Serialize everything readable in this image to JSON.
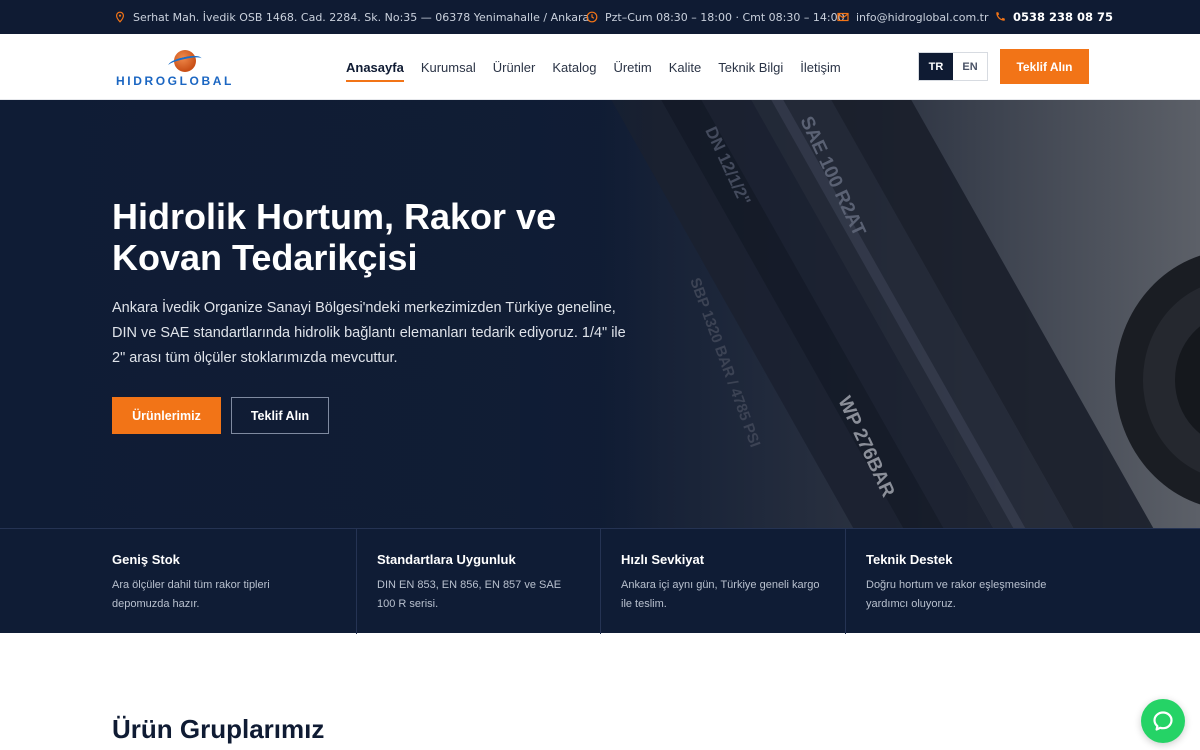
{
  "topbar": {
    "address": "Serhat Mah. İvedik OSB 1468. Cad. 2284. Sk. No:35 — 06378 Yenimahalle / Ankara",
    "hours": "Pzt–Cum 08:30 – 18:00 · Cmt 08:30 – 14:00",
    "email": "info@hidroglobal.com.tr",
    "phone": "0538 238 08 75"
  },
  "header": {
    "logo_text": "HIDROGLOBAL",
    "nav": [
      "Anasayfa",
      "Kurumsal",
      "Ürünler",
      "Katalog",
      "Üretim",
      "Kalite",
      "Teknik Bilgi",
      "İletişim"
    ],
    "lang_active": "TR",
    "lang_other": "EN",
    "cta": "Teklif Alın"
  },
  "hero": {
    "title": "Hidrolik Hortum, Rakor ve Kovan Tedarikçisi",
    "description": "Ankara İvedik Organize Sanayi Bölgesi'ndeki merkezimizden Türkiye geneline, DIN ve SAE standartlarında hidrolik bağlantı elemanları tedarik ediyoruz. 1/4\" ile 2\" arası tüm ölçüler stoklarımızda mevcuttur.",
    "primary_button": "Ürünlerimiz",
    "secondary_button": "Teklif Alın",
    "hose_print_1": "SAE 100 R2AT",
    "hose_print_2": "WP 276BAR",
    "hose_print_3": "DN 12/1/2\"",
    "hose_print_4": "SBP 1320 BAR / 4785 PSI"
  },
  "features": [
    {
      "title": "Geniş Stok",
      "text": "Ara ölçüler dahil tüm rakor tipleri depomuzda hazır."
    },
    {
      "title": "Standartlara Uygunluk",
      "text": "DIN EN 853, EN 856, EN 857 ve SAE 100 R serisi."
    },
    {
      "title": "Hızlı Sevkiyat",
      "text": "Ankara içi aynı gün, Türkiye geneli kargo ile teslim."
    },
    {
      "title": "Teknik Destek",
      "text": "Doğru hortum ve rakor eşleşmesinde yardımcı oluyoruz."
    }
  ],
  "section": {
    "title": "Ürün Gruplarımız"
  },
  "colors": {
    "navy": "#0f1b33",
    "accent": "#f27417",
    "whatsapp": "#25d366"
  }
}
